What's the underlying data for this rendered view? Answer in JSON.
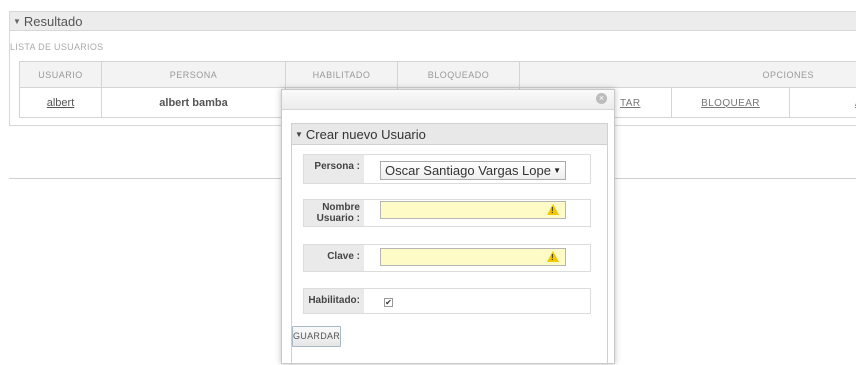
{
  "panel": {
    "title": "Resultado",
    "list_title": "LISTA DE USUARIOS"
  },
  "table": {
    "headers": [
      "USUARIO",
      "PERSONA",
      "HABILITADO",
      "BLOQUEADO",
      "OPCIONES"
    ],
    "row": {
      "usuario": "albert",
      "persona": "albert bamba",
      "opt_partial": "TAR",
      "bloquear": "BLOQUEAR",
      "opt_last": "A"
    }
  },
  "modal": {
    "close_glyph": "×",
    "fieldset_title": "Crear nuevo Usuario",
    "persona_label": "Persona :",
    "persona_value": "Oscar Santiago Vargas Lope",
    "nombre_label_1": "Nombre",
    "nombre_label_2": "Usuario :",
    "clave_label": "Clave :",
    "habilitado_label": "Habilitado:",
    "habilitado_checked": "✔",
    "warn_glyph": "!",
    "save_label": "GUARDAR"
  },
  "colors": {
    "warn_input_bg": "#fffbc6",
    "warn_icon": "#f3c700"
  }
}
